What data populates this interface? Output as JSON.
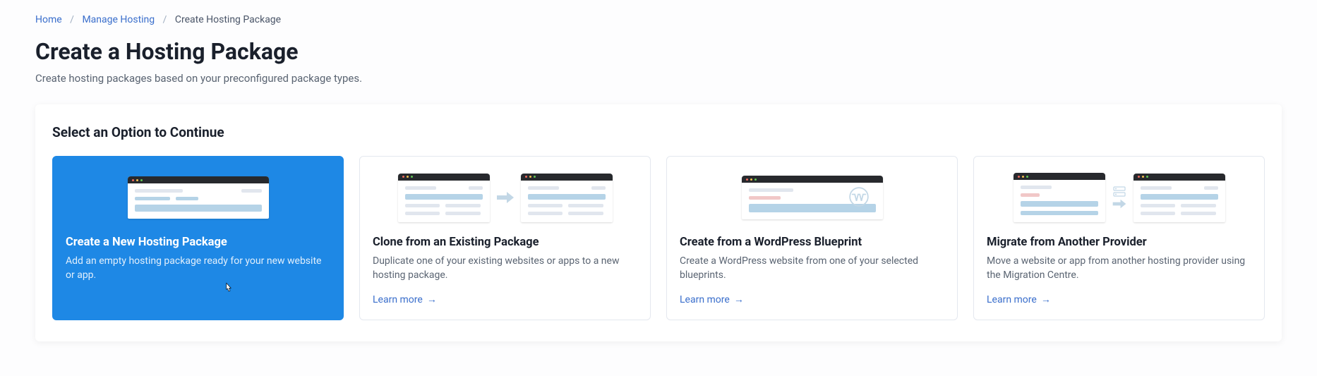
{
  "breadcrumb": {
    "home": "Home",
    "manage_hosting": "Manage Hosting",
    "current": "Create Hosting Package"
  },
  "page": {
    "title": "Create a Hosting Package",
    "subtitle": "Create hosting packages based on your preconfigured package types."
  },
  "panel": {
    "heading": "Select an Option to Continue"
  },
  "cards": [
    {
      "title": "Create a New Hosting Package",
      "desc": "Add an empty hosting package ready for your new website or app.",
      "learn_more": ""
    },
    {
      "title": "Clone from an Existing Package",
      "desc": "Duplicate one of your existing websites or apps to a new hosting package.",
      "learn_more": "Learn more"
    },
    {
      "title": "Create from a WordPress Blueprint",
      "desc": "Create a WordPress website from one of your selected blueprints.",
      "learn_more": "Learn more"
    },
    {
      "title": "Migrate from Another Provider",
      "desc": "Move a website or app from another hosting provider using the Migration Centre.",
      "learn_more": "Learn more"
    }
  ]
}
